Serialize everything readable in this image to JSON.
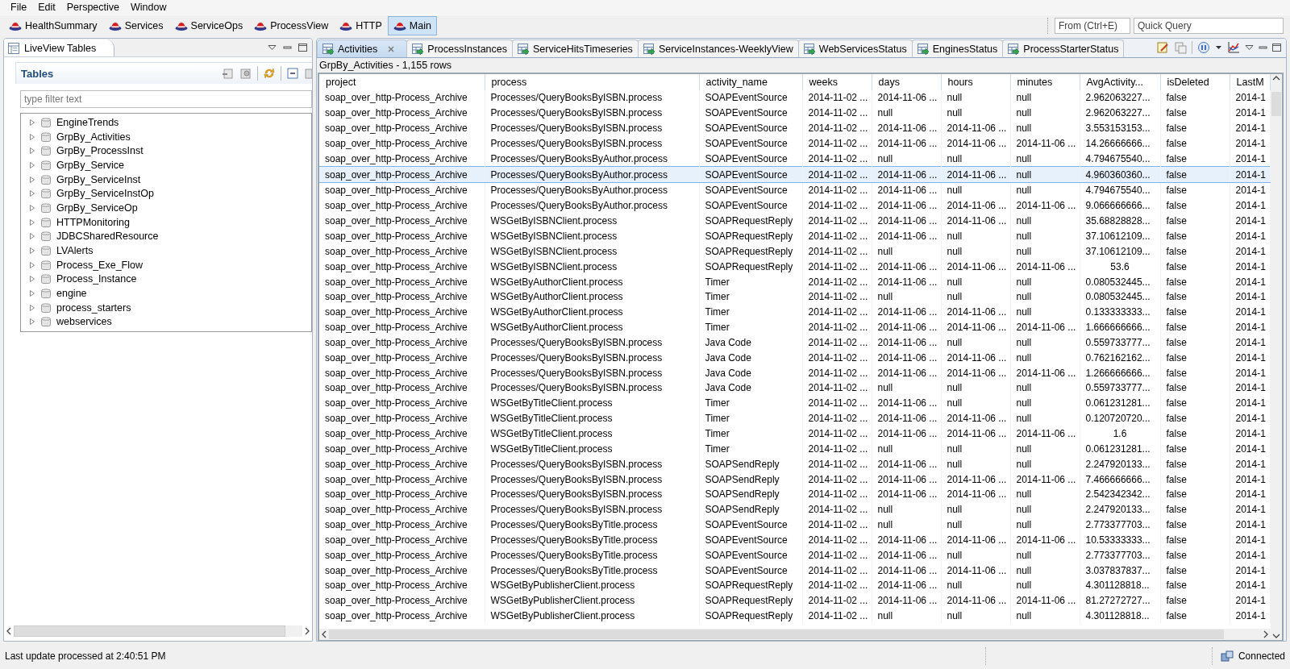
{
  "menu": [
    "File",
    "Edit",
    "Perspective",
    "Window"
  ],
  "perspectives": [
    {
      "label": "HealthSummary",
      "selected": false
    },
    {
      "label": "Services",
      "selected": false
    },
    {
      "label": "ServiceOps",
      "selected": false
    },
    {
      "label": "ProcessView",
      "selected": false
    },
    {
      "label": "HTTP",
      "selected": false
    },
    {
      "label": "Main",
      "selected": true
    }
  ],
  "shortcut_field": {
    "placeholder": "From (Ctrl+E)"
  },
  "quick_query": {
    "placeholder": "Quick Query"
  },
  "left_panel": {
    "title": "LiveView Tables",
    "section_title": "Tables",
    "filter": {
      "placeholder": "type filter text"
    },
    "tree": [
      {
        "label": "EngineTrends",
        "expanded": false
      },
      {
        "label": "GrpBy_Activities",
        "expanded": false
      },
      {
        "label": "GrpBy_ProcessInst",
        "expanded": false
      },
      {
        "label": "GrpBy_Service",
        "expanded": false
      },
      {
        "label": "GrpBy_ServiceInst",
        "expanded": false
      },
      {
        "label": "GrpBy_ServiceInstOp",
        "expanded": false
      },
      {
        "label": "GrpBy_ServiceOp",
        "expanded": false
      },
      {
        "label": "HTTPMonitoring",
        "expanded": false
      },
      {
        "label": "JDBCSharedResource",
        "expanded": false
      },
      {
        "label": "LVAlerts",
        "expanded": false
      },
      {
        "label": "Process_Exe_Flow",
        "expanded": false
      },
      {
        "label": "Process_Instance",
        "expanded": false
      },
      {
        "label": "engine",
        "expanded": false
      },
      {
        "label": "process_starters",
        "expanded": false
      },
      {
        "label": "webservices",
        "expanded": false
      }
    ]
  },
  "editor_tabs": [
    {
      "label": "Activities",
      "selected": true
    },
    {
      "label": "ProcessInstances",
      "selected": false
    },
    {
      "label": "ServiceHitsTimeseries",
      "selected": false
    },
    {
      "label": "ServiceInstances-WeeklyView",
      "selected": false
    },
    {
      "label": "WebServicesStatus",
      "selected": false
    },
    {
      "label": "EnginesStatus",
      "selected": false
    },
    {
      "label": "ProcessStarterStatus",
      "selected": false
    }
  ],
  "table_caption": "GrpBy_Activities - 1,155 rows",
  "table": {
    "columns": [
      "project",
      "process",
      "activity_name",
      "weeks",
      "days",
      "hours",
      "minutes",
      "AvgActivity...",
      "isDeleted",
      "LastM"
    ],
    "rows": [
      {
        "selected": false,
        "cells": [
          "soap_over_http-Process_Archive",
          "Processes/QueryBooksByISBN.process",
          "SOAPEventSource",
          "2014-11-02 ...",
          "2014-11-06 ...",
          "null",
          "null",
          "2.962063227...",
          "false",
          "2014-1"
        ]
      },
      {
        "selected": false,
        "cells": [
          "soap_over_http-Process_Archive",
          "Processes/QueryBooksByISBN.process",
          "SOAPEventSource",
          "2014-11-02 ...",
          "null",
          "null",
          "null",
          "2.962063227...",
          "false",
          "2014-1"
        ]
      },
      {
        "selected": false,
        "cells": [
          "soap_over_http-Process_Archive",
          "Processes/QueryBooksByISBN.process",
          "SOAPEventSource",
          "2014-11-02 ...",
          "2014-11-06 ...",
          "2014-11-06 ...",
          "null",
          "3.553153153...",
          "false",
          "2014-1"
        ]
      },
      {
        "selected": false,
        "cells": [
          "soap_over_http-Process_Archive",
          "Processes/QueryBooksByISBN.process",
          "SOAPEventSource",
          "2014-11-02 ...",
          "2014-11-06 ...",
          "2014-11-06 ...",
          "2014-11-06 ...",
          "14.26666666...",
          "false",
          "2014-1"
        ]
      },
      {
        "selected": false,
        "cells": [
          "soap_over_http-Process_Archive",
          "Processes/QueryBooksByAuthor.process",
          "SOAPEventSource",
          "2014-11-02 ...",
          "null",
          "null",
          "null",
          "4.794675540...",
          "false",
          "2014-1"
        ]
      },
      {
        "selected": true,
        "cells": [
          "soap_over_http-Process_Archive",
          "Processes/QueryBooksByAuthor.process",
          "SOAPEventSource",
          "2014-11-02 ...",
          "2014-11-06 ...",
          "2014-11-06 ...",
          "null",
          "4.960360360...",
          "false",
          "2014-1"
        ]
      },
      {
        "selected": false,
        "cells": [
          "soap_over_http-Process_Archive",
          "Processes/QueryBooksByAuthor.process",
          "SOAPEventSource",
          "2014-11-02 ...",
          "2014-11-06 ...",
          "null",
          "null",
          "4.794675540...",
          "false",
          "2014-1"
        ]
      },
      {
        "selected": false,
        "cells": [
          "soap_over_http-Process_Archive",
          "Processes/QueryBooksByAuthor.process",
          "SOAPEventSource",
          "2014-11-02 ...",
          "2014-11-06 ...",
          "2014-11-06 ...",
          "2014-11-06 ...",
          "9.066666666...",
          "false",
          "2014-1"
        ]
      },
      {
        "selected": false,
        "cells": [
          "soap_over_http-Process_Archive",
          "WSGetByISBNClient.process",
          "SOAPRequestReply",
          "2014-11-02 ...",
          "2014-11-06 ...",
          "2014-11-06 ...",
          "null",
          "35.68828828...",
          "false",
          "2014-1"
        ]
      },
      {
        "selected": false,
        "cells": [
          "soap_over_http-Process_Archive",
          "WSGetByISBNClient.process",
          "SOAPRequestReply",
          "2014-11-02 ...",
          "2014-11-06 ...",
          "null",
          "null",
          "37.10612109...",
          "false",
          "2014-1"
        ]
      },
      {
        "selected": false,
        "cells": [
          "soap_over_http-Process_Archive",
          "WSGetByISBNClient.process",
          "SOAPRequestReply",
          "2014-11-02 ...",
          "null",
          "null",
          "null",
          "37.10612109...",
          "false",
          "2014-1"
        ]
      },
      {
        "selected": false,
        "cells": [
          "soap_over_http-Process_Archive",
          "WSGetByISBNClient.process",
          "SOAPRequestReply",
          "2014-11-02 ...",
          "2014-11-06 ...",
          "2014-11-06 ...",
          "2014-11-06 ...",
          "53.6",
          "false",
          "2014-1"
        ]
      },
      {
        "selected": false,
        "cells": [
          "soap_over_http-Process_Archive",
          "WSGetByAuthorClient.process",
          "Timer",
          "2014-11-02 ...",
          "2014-11-06 ...",
          "null",
          "null",
          "0.080532445...",
          "false",
          "2014-1"
        ]
      },
      {
        "selected": false,
        "cells": [
          "soap_over_http-Process_Archive",
          "WSGetByAuthorClient.process",
          "Timer",
          "2014-11-02 ...",
          "null",
          "null",
          "null",
          "0.080532445...",
          "false",
          "2014-1"
        ]
      },
      {
        "selected": false,
        "cells": [
          "soap_over_http-Process_Archive",
          "WSGetByAuthorClient.process",
          "Timer",
          "2014-11-02 ...",
          "2014-11-06 ...",
          "2014-11-06 ...",
          "null",
          "0.133333333...",
          "false",
          "2014-1"
        ]
      },
      {
        "selected": false,
        "cells": [
          "soap_over_http-Process_Archive",
          "WSGetByAuthorClient.process",
          "Timer",
          "2014-11-02 ...",
          "2014-11-06 ...",
          "2014-11-06 ...",
          "2014-11-06 ...",
          "1.666666666...",
          "false",
          "2014-1"
        ]
      },
      {
        "selected": false,
        "cells": [
          "soap_over_http-Process_Archive",
          "Processes/QueryBooksByISBN.process",
          "Java Code",
          "2014-11-02 ...",
          "2014-11-06 ...",
          "null",
          "null",
          "0.559733777...",
          "false",
          "2014-1"
        ]
      },
      {
        "selected": false,
        "cells": [
          "soap_over_http-Process_Archive",
          "Processes/QueryBooksByISBN.process",
          "Java Code",
          "2014-11-02 ...",
          "2014-11-06 ...",
          "2014-11-06 ...",
          "null",
          "0.762162162...",
          "false",
          "2014-1"
        ]
      },
      {
        "selected": false,
        "cells": [
          "soap_over_http-Process_Archive",
          "Processes/QueryBooksByISBN.process",
          "Java Code",
          "2014-11-02 ...",
          "2014-11-06 ...",
          "2014-11-06 ...",
          "2014-11-06 ...",
          "1.266666666...",
          "false",
          "2014-1"
        ]
      },
      {
        "selected": false,
        "cells": [
          "soap_over_http-Process_Archive",
          "Processes/QueryBooksByISBN.process",
          "Java Code",
          "2014-11-02 ...",
          "null",
          "null",
          "null",
          "0.559733777...",
          "false",
          "2014-1"
        ]
      },
      {
        "selected": false,
        "cells": [
          "soap_over_http-Process_Archive",
          "WSGetByTitleClient.process",
          "Timer",
          "2014-11-02 ...",
          "2014-11-06 ...",
          "null",
          "null",
          "0.061231281...",
          "false",
          "2014-1"
        ]
      },
      {
        "selected": false,
        "cells": [
          "soap_over_http-Process_Archive",
          "WSGetByTitleClient.process",
          "Timer",
          "2014-11-02 ...",
          "2014-11-06 ...",
          "2014-11-06 ...",
          "null",
          "0.120720720...",
          "false",
          "2014-1"
        ]
      },
      {
        "selected": false,
        "cells": [
          "soap_over_http-Process_Archive",
          "WSGetByTitleClient.process",
          "Timer",
          "2014-11-02 ...",
          "2014-11-06 ...",
          "2014-11-06 ...",
          "2014-11-06 ...",
          "1.6",
          "false",
          "2014-1"
        ]
      },
      {
        "selected": false,
        "cells": [
          "soap_over_http-Process_Archive",
          "WSGetByTitleClient.process",
          "Timer",
          "2014-11-02 ...",
          "null",
          "null",
          "null",
          "0.061231281...",
          "false",
          "2014-1"
        ]
      },
      {
        "selected": false,
        "cells": [
          "soap_over_http-Process_Archive",
          "Processes/QueryBooksByISBN.process",
          "SOAPSendReply",
          "2014-11-02 ...",
          "2014-11-06 ...",
          "null",
          "null",
          "2.247920133...",
          "false",
          "2014-1"
        ]
      },
      {
        "selected": false,
        "cells": [
          "soap_over_http-Process_Archive",
          "Processes/QueryBooksByISBN.process",
          "SOAPSendReply",
          "2014-11-02 ...",
          "2014-11-06 ...",
          "2014-11-06 ...",
          "2014-11-06 ...",
          "7.466666666...",
          "false",
          "2014-1"
        ]
      },
      {
        "selected": false,
        "cells": [
          "soap_over_http-Process_Archive",
          "Processes/QueryBooksByISBN.process",
          "SOAPSendReply",
          "2014-11-02 ...",
          "2014-11-06 ...",
          "2014-11-06 ...",
          "null",
          "2.542342342...",
          "false",
          "2014-1"
        ]
      },
      {
        "selected": false,
        "cells": [
          "soap_over_http-Process_Archive",
          "Processes/QueryBooksByISBN.process",
          "SOAPSendReply",
          "2014-11-02 ...",
          "null",
          "null",
          "null",
          "2.247920133...",
          "false",
          "2014-1"
        ]
      },
      {
        "selected": false,
        "cells": [
          "soap_over_http-Process_Archive",
          "Processes/QueryBooksByTitle.process",
          "SOAPEventSource",
          "2014-11-02 ...",
          "null",
          "null",
          "null",
          "2.773377703...",
          "false",
          "2014-1"
        ]
      },
      {
        "selected": false,
        "cells": [
          "soap_over_http-Process_Archive",
          "Processes/QueryBooksByTitle.process",
          "SOAPEventSource",
          "2014-11-02 ...",
          "2014-11-06 ...",
          "2014-11-06 ...",
          "2014-11-06 ...",
          "10.53333333...",
          "false",
          "2014-1"
        ]
      },
      {
        "selected": false,
        "cells": [
          "soap_over_http-Process_Archive",
          "Processes/QueryBooksByTitle.process",
          "SOAPEventSource",
          "2014-11-02 ...",
          "2014-11-06 ...",
          "null",
          "null",
          "2.773377703...",
          "false",
          "2014-1"
        ]
      },
      {
        "selected": false,
        "cells": [
          "soap_over_http-Process_Archive",
          "Processes/QueryBooksByTitle.process",
          "SOAPEventSource",
          "2014-11-02 ...",
          "2014-11-06 ...",
          "2014-11-06 ...",
          "null",
          "3.037837837...",
          "false",
          "2014-1"
        ]
      },
      {
        "selected": false,
        "cells": [
          "soap_over_http-Process_Archive",
          "WSGetByPublisherClient.process",
          "SOAPRequestReply",
          "2014-11-02 ...",
          "2014-11-06 ...",
          "null",
          "null",
          "4.301128818...",
          "false",
          "2014-1"
        ]
      },
      {
        "selected": false,
        "cells": [
          "soap_over_http-Process_Archive",
          "WSGetByPublisherClient.process",
          "SOAPRequestReply",
          "2014-11-02 ...",
          "2014-11-06 ...",
          "2014-11-06 ...",
          "2014-11-06 ...",
          "81.27272727...",
          "false",
          "2014-1"
        ]
      },
      {
        "selected": false,
        "cells": [
          "soap_over_http-Process_Archive",
          "WSGetByPublisherClient.process",
          "SOAPRequestReply",
          "2014-11-02 ...",
          "null",
          "null",
          "null",
          "4.301128818...",
          "false",
          "2014-1"
        ]
      }
    ]
  },
  "status_bar": {
    "message": "Last update processed at 2:40:51 PM",
    "connection": "Connected"
  }
}
